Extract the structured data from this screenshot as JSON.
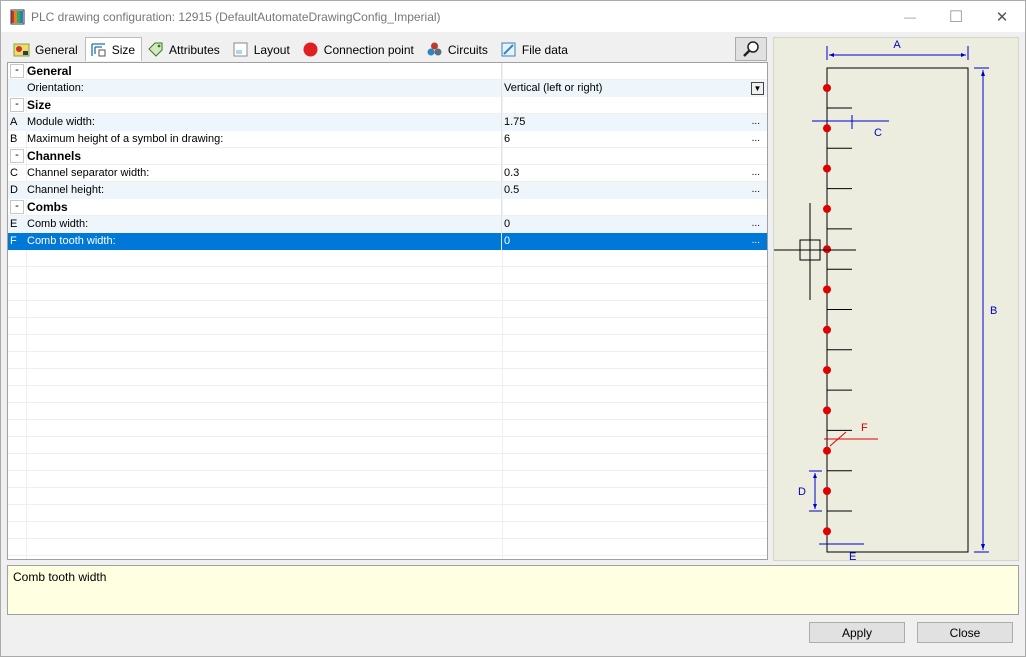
{
  "window": {
    "title": "PLC drawing configuration: 12915 (DefaultAutomateDrawingConfig_Imperial)",
    "controls": {
      "minimize": "—",
      "maximize": "☐",
      "close": "✕"
    }
  },
  "tabs": [
    {
      "label": "General",
      "icon": "general-icon"
    },
    {
      "label": "Size",
      "icon": "size-icon",
      "active": true
    },
    {
      "label": "Attributes",
      "icon": "attributes-icon"
    },
    {
      "label": "Layout",
      "icon": "layout-icon"
    },
    {
      "label": "Connection point",
      "icon": "connection-point-icon"
    },
    {
      "label": "Circuits",
      "icon": "circuits-icon"
    },
    {
      "label": "File data",
      "icon": "file-data-icon"
    }
  ],
  "grid": {
    "rows": [
      {
        "type": "group",
        "toggle": "-",
        "name": "General"
      },
      {
        "type": "prop",
        "key": "",
        "name": "Orientation:",
        "value": "Vertical (left or right)",
        "dropdown": "▼"
      },
      {
        "type": "group",
        "toggle": "-",
        "name": "Size"
      },
      {
        "type": "prop",
        "key": "A",
        "name": "Module width:",
        "value": "1.75",
        "ellipsis": "..."
      },
      {
        "type": "prop",
        "key": "B",
        "name": "Maximum height of a symbol in drawing:",
        "value": "6",
        "ellipsis": "..."
      },
      {
        "type": "group",
        "toggle": "-",
        "name": "Channels"
      },
      {
        "type": "prop",
        "key": "C",
        "name": "Channel separator width:",
        "value": "0.3",
        "ellipsis": "..."
      },
      {
        "type": "prop",
        "key": "D",
        "name": "Channel height:",
        "value": "0.5",
        "ellipsis": "..."
      },
      {
        "type": "group",
        "toggle": "-",
        "name": "Combs"
      },
      {
        "type": "prop",
        "key": "E",
        "name": "Comb width:",
        "value": "0",
        "ellipsis": "..."
      },
      {
        "type": "prop",
        "key": "F",
        "name": "Comb tooth width:",
        "value": "0",
        "ellipsis": "...",
        "selected": true
      }
    ]
  },
  "preview": {
    "labels": {
      "a": "A",
      "b": "B",
      "c": "C",
      "d": "D",
      "e": "E",
      "f": "F"
    },
    "colors": {
      "dimension": "#0000cc",
      "point": "#e00000",
      "f_marker": "#e00000"
    }
  },
  "description": "Comb tooth width",
  "buttons": {
    "apply": "Apply",
    "close": "Close"
  }
}
